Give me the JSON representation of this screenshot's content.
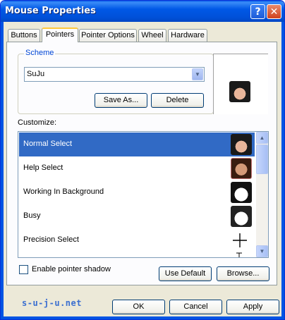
{
  "window": {
    "title": "Mouse Properties",
    "help_glyph": "?",
    "close_glyph": "✕"
  },
  "tabs": [
    {
      "label": "Buttons"
    },
    {
      "label": "Pointers"
    },
    {
      "label": "Pointer Options"
    },
    {
      "label": "Wheel"
    },
    {
      "label": "Hardware"
    }
  ],
  "scheme": {
    "legend": "Scheme",
    "selected": "SuJu",
    "save_as_label": "Save As...",
    "delete_label": "Delete"
  },
  "customize": {
    "label": "Customize:",
    "items": [
      {
        "label": "Normal Select",
        "icon": "suju-face-icon"
      },
      {
        "label": "Help Select",
        "icon": "suju-face-icon"
      },
      {
        "label": "Working In Background",
        "icon": "cartoon-face-icon"
      },
      {
        "label": "Busy",
        "icon": "cartoon-face-icon"
      },
      {
        "label": "Precision Select",
        "icon": "crosshair-icon"
      }
    ],
    "selected_index": 0
  },
  "shadow_checkbox": {
    "label": "Enable pointer shadow",
    "checked": false
  },
  "buttons": {
    "use_default": "Use Default",
    "browse": "Browse...",
    "ok": "OK",
    "cancel": "Cancel",
    "apply": "Apply"
  },
  "watermark": "s-u-j-u.net",
  "colors": {
    "title_bar": "#0054e3",
    "selection": "#316ac5",
    "accent_link": "#0046d5"
  }
}
